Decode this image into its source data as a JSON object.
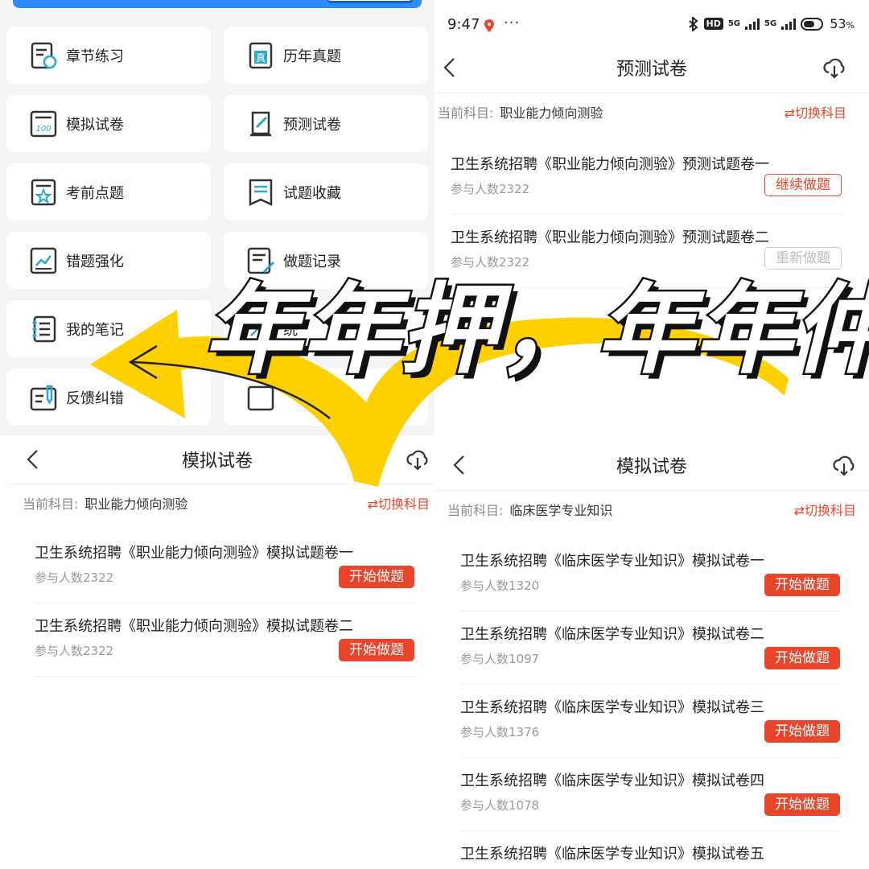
{
  "menu": {
    "items": [
      {
        "label": "章节练习",
        "icon": "chapter-practice-icon"
      },
      {
        "label": "历年真题",
        "icon": "past-exams-icon"
      },
      {
        "label": "模拟试卷",
        "icon": "mock-paper-icon"
      },
      {
        "label": "预测试卷",
        "icon": "predict-paper-icon"
      },
      {
        "label": "考前点题",
        "icon": "key-points-icon"
      },
      {
        "label": "试题收藏",
        "icon": "favorites-icon"
      },
      {
        "label": "错题强化",
        "icon": "wrong-questions-icon"
      },
      {
        "label": "做题记录",
        "icon": "practice-record-icon"
      },
      {
        "label": "我的笔记",
        "icon": "notes-icon"
      },
      {
        "label": "统",
        "icon": "statistics-icon"
      },
      {
        "label": "反馈纠错",
        "icon": "feedback-icon"
      }
    ]
  },
  "status_bar": {
    "time": "9:47",
    "dots": "···",
    "hd": "HD",
    "net1": "5G",
    "net2": "5G",
    "battery": "53",
    "battery_unit": "%"
  },
  "predict_panel": {
    "title": "预测试卷",
    "subject_label": "当前科目:",
    "subject_value": "职业能力倾向测验",
    "switch_label": "⇄切换科目",
    "items": [
      {
        "title": "卫生系统招聘《职业能力倾向测验》预测试题卷一",
        "count": "参与人数2322",
        "button": "继续做题"
      },
      {
        "title": "卫生系统招聘《职业能力倾向测验》预测试题卷二",
        "count": "参与人数2322",
        "button": "重新做题"
      }
    ]
  },
  "mock_panel_left": {
    "title": "模拟试卷",
    "subject_label": "当前科目:",
    "subject_value": "职业能力倾向测验",
    "switch_label": "⇄切换科目",
    "items": [
      {
        "title": "卫生系统招聘《职业能力倾向测验》模拟试题卷一",
        "count": "参与人数2322",
        "button": "开始做题"
      },
      {
        "title": "卫生系统招聘《职业能力倾向测验》模拟试题卷二",
        "count": "参与人数2322",
        "button": "开始做题"
      }
    ]
  },
  "mock_panel_right": {
    "title": "模拟试卷",
    "subject_label": "当前科目:",
    "subject_value": "临床医学专业知识",
    "switch_label": "⇄切换科目",
    "items": [
      {
        "title": "卫生系统招聘《临床医学专业知识》模拟试卷一",
        "count": "参与人数1320",
        "button": "开始做题"
      },
      {
        "title": "卫生系统招聘《临床医学专业知识》模拟试卷二",
        "count": "参与人数1097",
        "button": "开始做题"
      },
      {
        "title": "卫生系统招聘《临床医学专业知识》模拟试卷三",
        "count": "参与人数1376",
        "button": "开始做题"
      },
      {
        "title": "卫生系统招聘《临床医学专业知识》模拟试卷四",
        "count": "参与人数1078",
        "button": "开始做题"
      },
      {
        "title": "卫生系统招聘《临床医学专业知识》模拟试卷五",
        "count": "",
        "button": ""
      }
    ]
  },
  "overlay": {
    "headline": "年年押，年年仲",
    "arrow_color": "#ffd000",
    "accent_color": "#e8452b"
  }
}
